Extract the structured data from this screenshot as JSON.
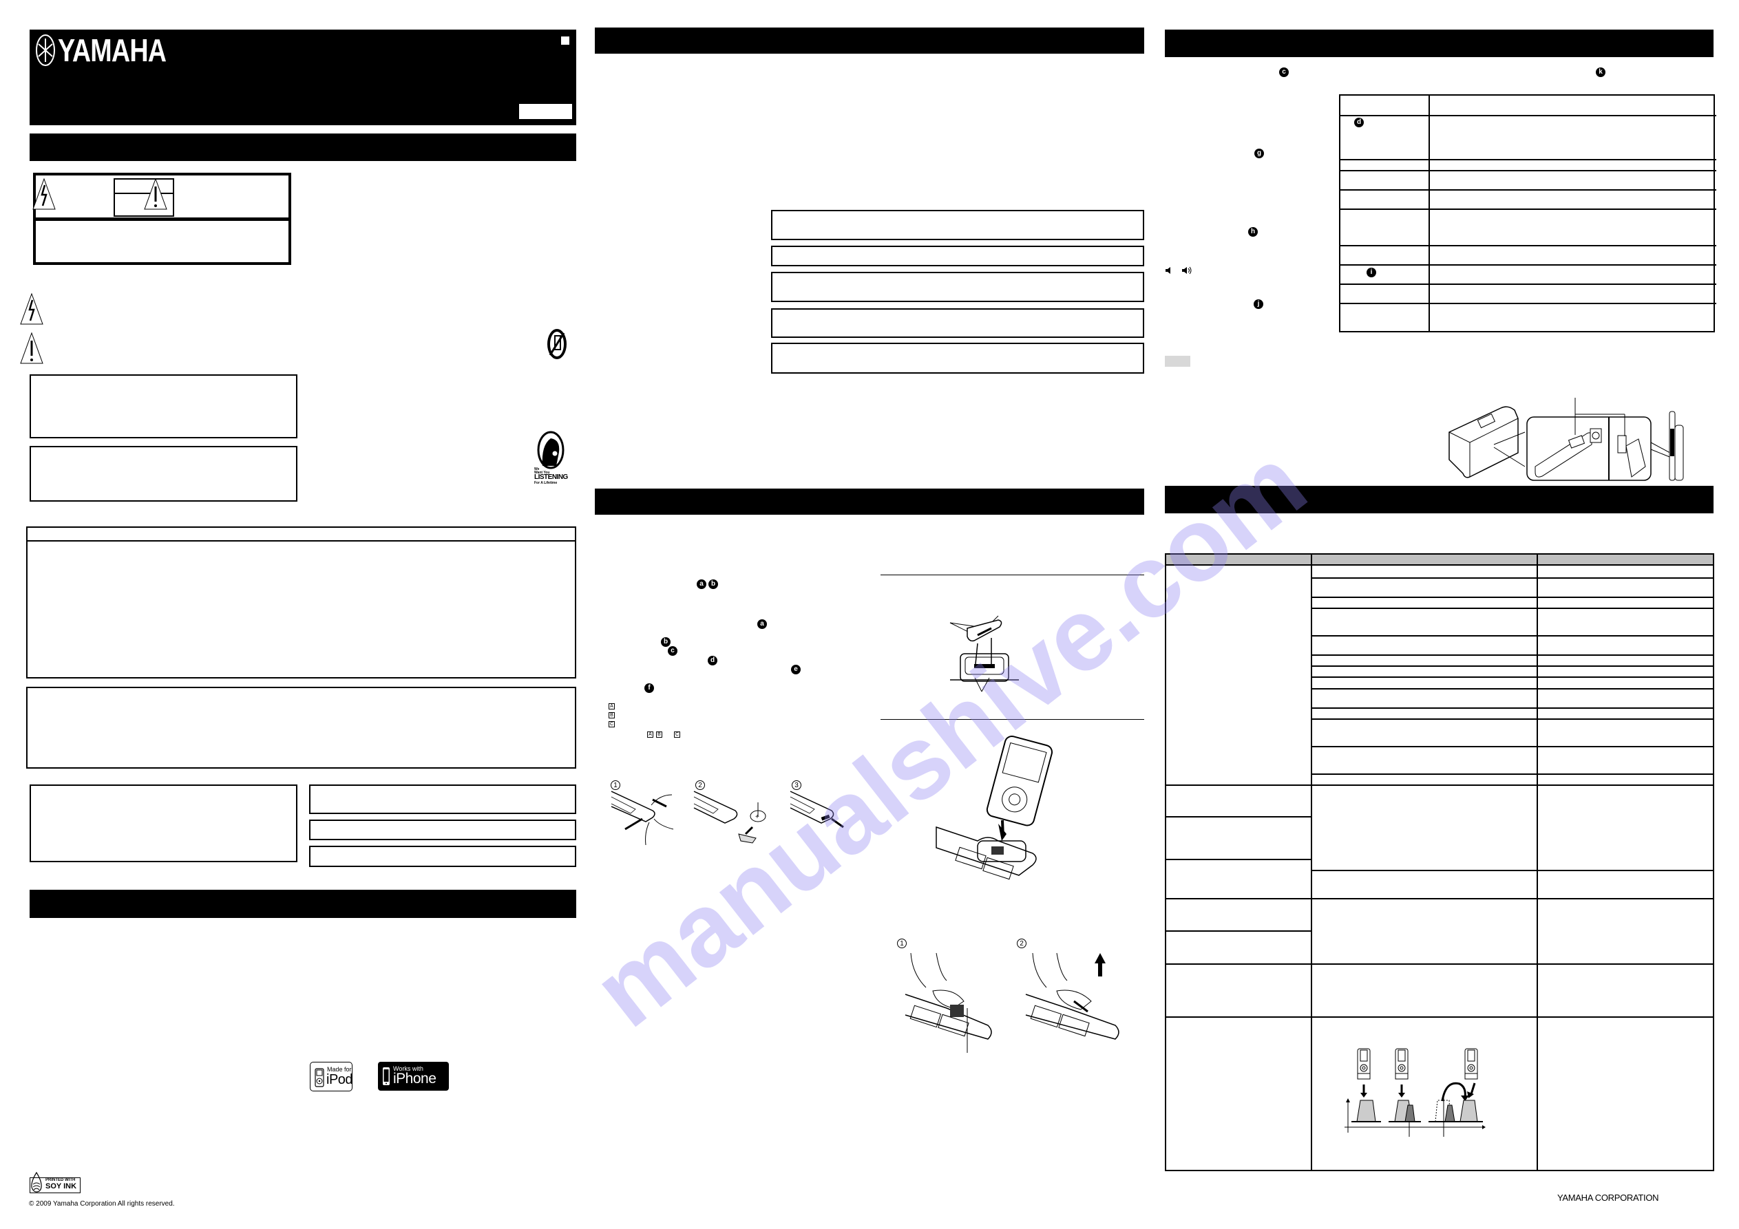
{
  "document": {
    "brand": "YAMAHA",
    "corporation": "YAMAHA CORPORATION",
    "copyright": "© 2009 Yamaha Corporation All rights reserved.",
    "watermark": "manualshive.com"
  },
  "logos": {
    "ipod_line1": "Made for",
    "ipod_line2": "iPod",
    "iphone_line1": "Works with",
    "iphone_line2": "iPhone",
    "soy_line1": "PRINTED WITH",
    "soy_line2": "SOY INK",
    "listening_line1": "We",
    "listening_line2": "Want You",
    "listening_line3": "LISTENING",
    "listening_line4": "For A Lifetime"
  },
  "badges": {
    "remote_ab": [
      "a",
      "b"
    ],
    "remote_a2": "a",
    "remote_b2": "b",
    "remote_c": "c",
    "remote_d": "d",
    "remote_e": "e",
    "remote_f": "f",
    "boxed": [
      "A",
      "B",
      "C"
    ],
    "boxed_inline": [
      "A",
      "B",
      "C"
    ],
    "controls_c": "c",
    "controls_d": "d",
    "controls_g": "g",
    "controls_h": "h",
    "controls_i": "i",
    "controls_j": "j",
    "controls_k": "k"
  },
  "steps": {
    "battery": [
      "1",
      "2",
      "3"
    ],
    "remove": [
      "1",
      "2"
    ]
  },
  "icons": {
    "dock_minus": "◄",
    "dock_plus": "►",
    "volume_down": "🔈",
    "volume_up": "🔊"
  }
}
